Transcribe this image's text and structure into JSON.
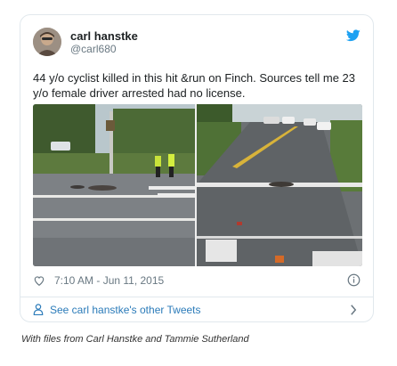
{
  "tweet": {
    "display_name": "carl hanstke",
    "handle": "@carl680",
    "text": "44 y/o cyclist killed in this hit &run on Finch.  Sources tell me 23 y/o female driver arrested had no license.",
    "timestamp": "7:10 AM - Jun 11, 2015",
    "footer_link": "See carl hanstke's other Tweets",
    "icons": {
      "brand": "bird-icon",
      "like": "heart-icon",
      "info": "info-icon",
      "profile": "person-icon",
      "more": "chevron-right-icon"
    },
    "colors": {
      "brand": "#1da1f2",
      "link": "#2b7bb9",
      "secondary_text": "#697882",
      "border": "#e1e8ed"
    }
  },
  "caption": "With files from Carl Hanstke and Tammie Sutherland"
}
